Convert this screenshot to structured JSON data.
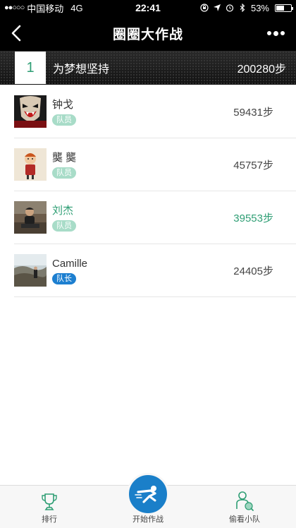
{
  "status_bar": {
    "carrier": "中国移动",
    "network": "4G",
    "time": "22:41",
    "battery_text": "53%",
    "battery_level": 0.53
  },
  "nav": {
    "title": "圈圈大作战"
  },
  "team": {
    "rank": "1",
    "name": "为梦想坚持",
    "steps": "200280步"
  },
  "members": [
    {
      "name": "钟戈",
      "role": "队员",
      "steps": "59431步",
      "highlight": false
    },
    {
      "name": "龑 龑",
      "role": "队员",
      "steps": "45757步",
      "highlight": false
    },
    {
      "name": "刘杰",
      "role": "队员",
      "steps": "39553步",
      "highlight": true
    },
    {
      "name": "Camille",
      "role": "队长",
      "steps": "24405步",
      "highlight": false
    }
  ],
  "tabs": {
    "rank_label": "排行",
    "battle_label": "开始作战",
    "peek_label": "偷看小队"
  },
  "colors": {
    "accent_green": "#2e9e74",
    "leader_blue": "#1d7fd0",
    "member_badge": "#a8dcc8"
  }
}
